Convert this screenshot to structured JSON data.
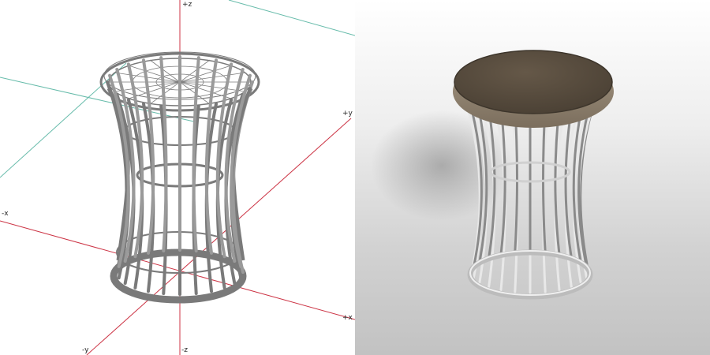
{
  "views": {
    "wireframe": {
      "axis_labels": {
        "z_pos": "+z",
        "z_neg": "-z",
        "y_pos": "+y",
        "y_neg": "-y",
        "x_pos": "+x",
        "x_neg": "-x"
      }
    },
    "render": {}
  },
  "colors": {
    "axis_primary": "#cc3344",
    "axis_secondary": "#66bbaa",
    "wire": "#7a7a7a",
    "seat_top": "#5b5040",
    "chrome": "#c8c8c8"
  }
}
